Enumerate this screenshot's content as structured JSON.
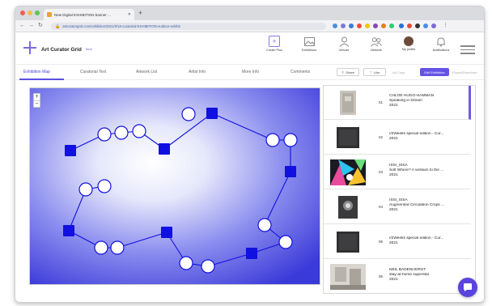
{
  "browser": {
    "tab_title": "New Digital EXHIBITION banner ...",
    "new_tab": "+",
    "url": "artcuratorgrid.com/exhibition/2021/0/18-curatorial-EXHIBITION-outdoor-exhibit",
    "traffic_colors": [
      "#ee5f56",
      "#f5bd4f",
      "#5fc453"
    ],
    "extension_colors": [
      "#4a90e2",
      "#7b7bd6",
      "#3a7bd5",
      "#e74c3c",
      "#f1c40f",
      "#8e44ad",
      "#e67e22",
      "#2ecc71"
    ]
  },
  "header": {
    "app_title": "Art Curator Grid",
    "beta": "Beta",
    "buttons": [
      {
        "label": "Create Plus",
        "icon": "plus-square-icon"
      },
      {
        "label": "Exhibitions",
        "icon": "picture-icon"
      },
      {
        "label": "Venues",
        "icon": "user-icon"
      },
      {
        "label": "Network",
        "icon": "users-icon"
      },
      {
        "label": "My profile",
        "icon": "avatar"
      },
      {
        "label": "Notifications",
        "icon": "bell-icon"
      }
    ]
  },
  "subnav": {
    "tabs": [
      "Exhibition Map",
      "Curatorial Text",
      "Artwork List",
      "Artist Info",
      "More Info",
      "Comments"
    ],
    "active_tab": "Exhibition Map",
    "share": "Share",
    "like": "Like",
    "edit_exhibition": "Edit Exhibition",
    "disabled_action": "Export/Download",
    "disabled_small": "Ad Copy"
  },
  "map": {
    "zoom_in": "+",
    "zoom_out": "−",
    "gradient_inner": "#ffffff",
    "gradient_outer": "#3a3ad9",
    "marker_color": "#1010e0"
  },
  "artworks": [
    {
      "num": "01",
      "artist": "CHLOÉ HUGO-HAMMAN",
      "title": "Speaking in Dream",
      "year": "2021"
    },
    {
      "num": "02",
      "artist": "",
      "title": "//2Weeks special edition - Cur...",
      "year": "2021"
    },
    {
      "num": "03",
      "artist": "ISSI_ISSA",
      "title": "Soft Where? A vestium to the ...",
      "year": "2021"
    },
    {
      "num": "04",
      "artist": "ISSI_ISSA",
      "title": "Augmented Circulation Crops ...",
      "year": "2021"
    },
    {
      "num": "05",
      "artist": "",
      "title": "//2Weeks special edition - Cur...",
      "year": "2021"
    },
    {
      "num": "06",
      "artist": "NEIL BADENHORST",
      "title": "stay-at-home superstar",
      "year": "2021"
    }
  ],
  "accent_color": "#5a50e0"
}
